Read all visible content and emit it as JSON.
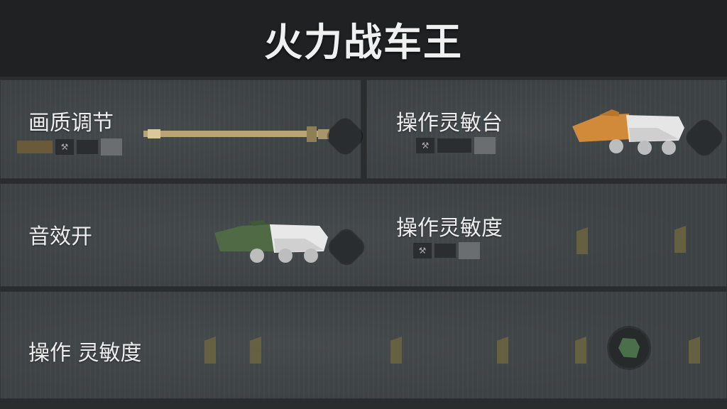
{
  "header": {
    "title": "火力战车王"
  },
  "settings": {
    "graphics_quality": {
      "label": "画质调节"
    },
    "control_sensitivity_top": {
      "label": "操作灵敏台"
    },
    "sound": {
      "label": "音效开"
    },
    "control_sensitivity_mid": {
      "label": "操作灵敏度"
    },
    "control_sensitivity_bottom": {
      "label": "操作 灵敏度"
    }
  },
  "colors": {
    "background": "#2a2d2e",
    "panel": "#3d4244",
    "header": "#1f2122",
    "tan_barrel": "#b8a474",
    "orange_vehicle": "#d08a3a",
    "green_vehicle": "#4f6a44",
    "white_vehicle": "#e8e8e8"
  },
  "icons": [
    "wrench-icon",
    "vehicle-icon",
    "hex-button-icon",
    "green-emblem-icon"
  ]
}
